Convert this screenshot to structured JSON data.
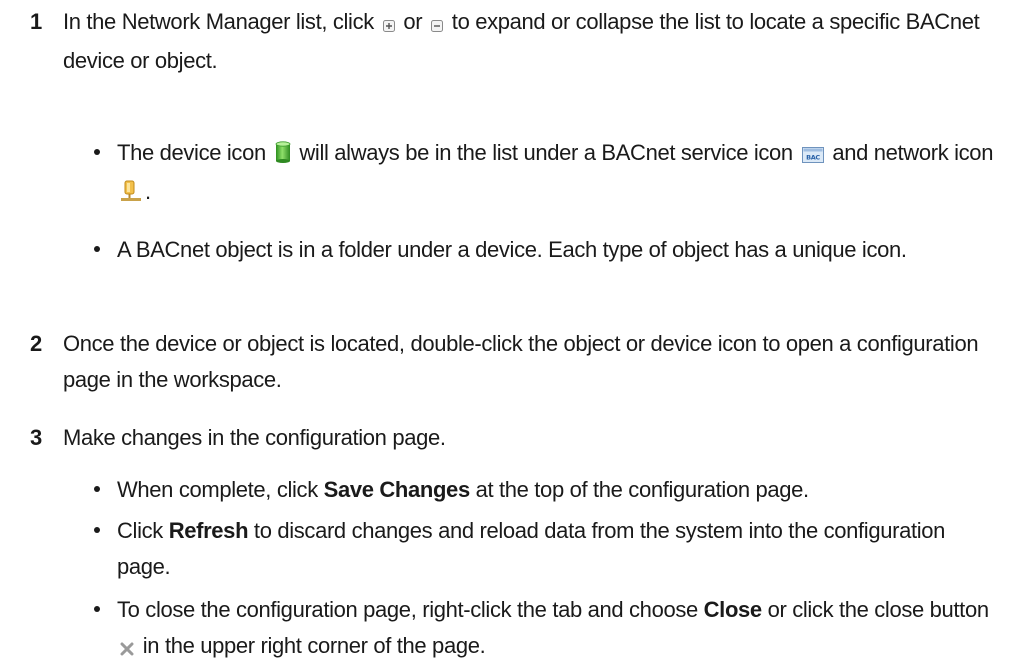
{
  "steps": [
    {
      "number": "1",
      "text_a": "In the Network Manager list, click ",
      "expand_icon": "plus-box-icon",
      "text_b": " or ",
      "collapse_icon": "minus-box-icon",
      "text_c": " to expand or collapse the list to locate a specific BACnet device or object.",
      "bullets": [
        {
          "text_a": "The device icon ",
          "device_icon": "green-cylinder-device-icon",
          "text_b": " will always be in the list under a BACnet service icon ",
          "service_icon": "bac-service-icon",
          "service_icon_label": "BAC",
          "text_c": " and network icon ",
          "network_icon": "yellow-network-pin-icon",
          "text_d": "."
        },
        {
          "text": "A BACnet object is in a folder under a device. Each type of object has a unique icon."
        }
      ]
    },
    {
      "number": "2",
      "text": "Once the device or object is located, double-click the object or device icon to open a configuration page in the workspace."
    },
    {
      "number": "3",
      "text": "Make changes in the configuration page.",
      "bullets": [
        {
          "text_a": "When complete, click ",
          "bold": "Save Changes",
          "text_b": " at the top of the configuration page."
        },
        {
          "text_a": "Click ",
          "bold": "Refresh",
          "text_b": " to discard changes and reload data from the system into the configuration page."
        },
        {
          "text_a": "To close the configuration page, right-click the tab and choose ",
          "bold": "Close",
          "text_b": " or click the close button ",
          "close_icon": "gray-x-close-icon",
          "text_c": " in the upper right corner of the page."
        }
      ]
    }
  ]
}
